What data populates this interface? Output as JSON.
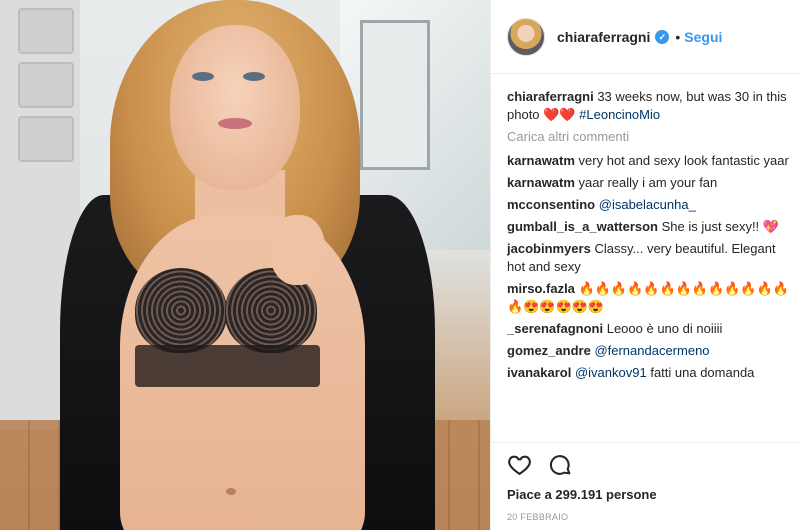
{
  "post": {
    "user": "chiaraferragni",
    "follow_label": "Segui",
    "dot": "•",
    "caption": {
      "user": "chiaraferragni",
      "text": "33 weeks now, but was 30 in this photo ❤️❤️",
      "hashtag": "#LeoncinoMio"
    },
    "load_more_label": "Carica altri commenti",
    "comments": [
      {
        "user": "karnawatm",
        "text": "very hot and sexy look fantastic yaar"
      },
      {
        "user": "karnawatm",
        "text": "yaar really i am your fan"
      },
      {
        "user": "mcconsentino",
        "mention": "@isabelacunha_",
        "text": ""
      },
      {
        "user": "gumball_is_a_watterson",
        "text": "She is just sexy!! 💖"
      },
      {
        "user": "jacobinmyers",
        "text": "Classy... very beautiful. Elegant hot and sexy"
      },
      {
        "user": "mirso.fazla",
        "text": "🔥🔥🔥🔥🔥🔥🔥🔥🔥🔥🔥🔥🔥🔥😍😍😍😍😍"
      },
      {
        "user": "_serenafagnoni",
        "text": "Leooo è uno di noiiii"
      },
      {
        "user": "gomez_andre",
        "mention": "@fernandacermeno",
        "text": ""
      },
      {
        "user": "ivanakarol",
        "mention": "@ivankov91",
        "text": "fatti una domanda"
      }
    ],
    "likes_text": "Piace a 299.191 persone",
    "date": "20 FEBBRAIO"
  },
  "icons": {
    "like": "heart-outline-icon",
    "comment": "comment-bubble-icon",
    "verified": "verified-badge-icon"
  },
  "colors": {
    "link_blue": "#3897f0",
    "mention_blue": "#003569",
    "muted": "#999999"
  }
}
